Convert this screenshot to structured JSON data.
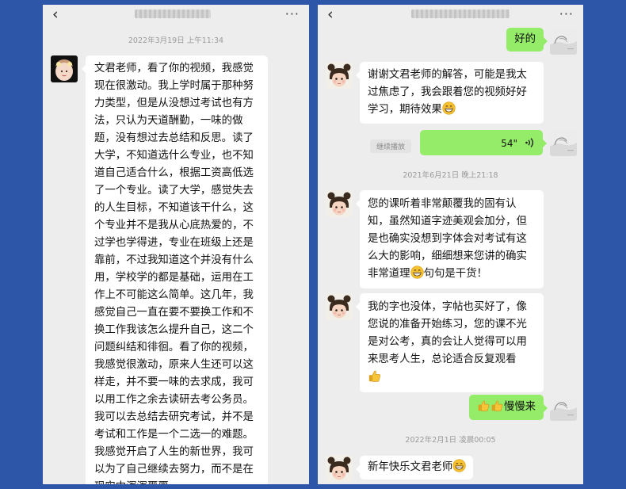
{
  "left_chat": {
    "timestamp": "2022年3月19日 上午11:34",
    "message": "文君老师，看了你的视频，我感觉现在很激动。我上学时属于那种努力类型，但是从没想过考试也有方法，只认为天道酬勤，一味的做题，没有想过去总结和反思。读了大学，不知道选什么专业，也不知道自己适合什么，根据工资高低选了一个专业。读了大学，感觉失去的人生目标，不知道该干什么，这个专业并不是我从心底热爱的，不过学也学得进，专业在班级上还是靠前，不过我知道这个并没有什么用，学校学的都是基础，运用在工作上不可能这么简单。这几年，我感觉自己一直在要不要换工作和不换工作我该怎么提升自己，这二个问题纠结和徘徊。看了你的视频，我感觉很激动，原来人生还可以这样走，并不要一味的去求成，我可以用工作之余去读研去考公务员。我可以去总结去研究考试，并不是考试和工作是一个二选一的难题。我感觉开启了人生的新世界，我可以为了自己继续去努力，而不是在现实中浑浑噩噩。"
  },
  "right_chat": {
    "msg_good": "好的",
    "msg_thanks": "谢谢文君老师的解答，可能是我太过焦虑了，我会跟着您的视频好好学习，期待效果",
    "continue_play": "继续播放",
    "voice_duration": "54\"",
    "timestamp_1": "2021年6月21日 晚上21:18",
    "msg_course_a": "您的课听着非常颠覆我的固有认知，虽然知道字迹美观会加分，但是也确实没想到字体会对考试有这么大的影响，细细想来您讲的确实非常道理",
    "msg_course_b": "句句是干货！",
    "msg_handwriting": "我的字也没体，字帖也买好了，像您说的准备开始练习，您的课不光是对公考，真的会让人觉得可以用来思考人生，总论适合反复观看",
    "msg_slowly": "慢慢来",
    "timestamp_2": "2022年2月1日 凌晨00:05",
    "msg_newyear": "新年快乐文君老师"
  },
  "icons": {
    "back": "‹",
    "more": "···",
    "back_icon": "chevron-left-icon",
    "more_icon": "more-dots-icon",
    "grin_emoji": "grin-emoji-icon",
    "thumbs_emoji": "thumbs-up-emoji-icon",
    "voice_icon": "voice-wave-icon"
  },
  "colors": {
    "background": "#2d56a8",
    "panel": "#ededed",
    "incoming_bubble": "#ffffff",
    "outgoing_bubble": "#95ec69"
  }
}
